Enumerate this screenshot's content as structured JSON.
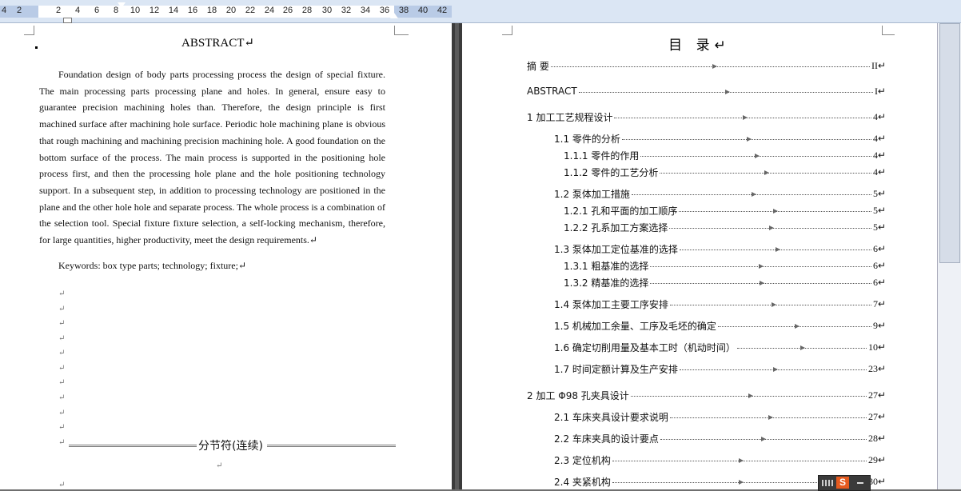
{
  "ruler": {
    "ticks": [
      "4",
      "2",
      "2",
      "4",
      "6",
      "8",
      "10",
      "12",
      "14",
      "16",
      "18",
      "20",
      "22",
      "24",
      "26",
      "28",
      "30",
      "32",
      "34",
      "36",
      "38",
      "40",
      "42"
    ]
  },
  "left_page": {
    "title": "ABSTRACT↵",
    "body": "Foundation design of body parts processing process the design of special fixture. The main processing parts processing plane and holes. In general, ensure easy to guarantee precision machining holes than. Therefore, the design principle is first machined surface after machining hole surface. Periodic hole machining plane is obvious that rough machining and machining precision machining hole. A good foundation on the bottom surface of the process. The main process is supported in the positioning hole process first, and then the processing hole plane and the hole positioning technology support. In a subsequent step, in addition to processing technology are positioned in the plane and the other hole hole and separate process. The whole process is a combination of the selection tool. Special fixture fixture selection, a self-locking mechanism, therefore, for large quantities, higher productivity, meet the design requirements.↵",
    "keywords": "Keywords: box type parts; technology; fixture;↵",
    "paragraph_mark": "↵",
    "section_break_label": "分节符(连续)"
  },
  "right_page": {
    "title": "目 录↵",
    "toc": [
      {
        "text": "摘   要",
        "page": "II↵"
      },
      {
        "text": "ABSTRACT",
        "page": "I↵"
      },
      {
        "text": "1  加工工艺规程设计",
        "page": "4↵"
      },
      {
        "text": "1.1  零件的分析",
        "page": "4↵"
      },
      {
        "text": "1.1.1  零件的作用",
        "page": "4↵"
      },
      {
        "text": "1.1.2  零件的工艺分析",
        "page": "4↵"
      },
      {
        "text": "1.2  泵体加工措施",
        "page": "5↵"
      },
      {
        "text": "1.2.1  孔和平面的加工顺序",
        "page": "5↵"
      },
      {
        "text": "1.2.2  孔系加工方案选择",
        "page": "5↵"
      },
      {
        "text": "1.3  泵体加工定位基准的选择",
        "page": "6↵"
      },
      {
        "text": "1.3.1  粗基准的选择",
        "page": "6↵"
      },
      {
        "text": "1.3.2  精基准的选择",
        "page": "6↵"
      },
      {
        "text": "1.4  泵体加工主要工序安排",
        "page": "7↵"
      },
      {
        "text": "1.5  机械加工余量、工序及毛坯的确定",
        "page": "9↵"
      },
      {
        "text": "1.6 确定切削用量及基本工时（机动时间）",
        "page": "10↵"
      },
      {
        "text": "1.7  时间定额计算及生产安排",
        "page": "23↵"
      },
      {
        "text": "2   加工 Φ98 孔夹具设计",
        "page": "27↵"
      },
      {
        "text": "2.1  车床夹具设计要求说明",
        "page": "27↵"
      },
      {
        "text": "2.2 车床夹具的设计要点",
        "page": "28↵"
      },
      {
        "text": "2.3  定位机构",
        "page": "29↵"
      },
      {
        "text": "2.4 夹紧机构",
        "page": "30↵"
      }
    ]
  },
  "ime_toolbar": {
    "logo": "S"
  }
}
